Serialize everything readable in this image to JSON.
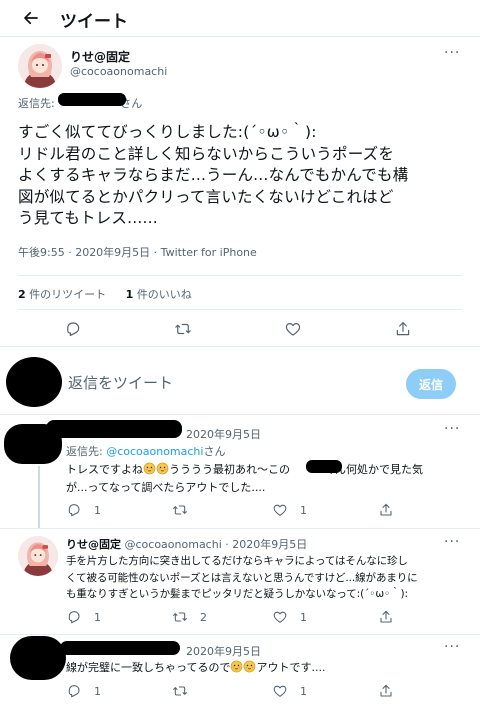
{
  "header": {
    "title": "ツイート"
  },
  "main_tweet": {
    "display_name": "りせ@固定",
    "handle": "@cocoaonomachi",
    "reply_to_prefix": "返信先: ",
    "reply_to_suffix": "さん",
    "body": "すごく似ててびっくりしました:(´◦ω◦｀):\nリドル君のこと詳しく知らないからこういうポーズを\nよくするキャラならまだ...うーん...なんでもかんでも構\n図が似てるとかパクリって言いたくないけどこれはど\nう見てもトレス......",
    "meta": "午後9:55 · 2020年9月5日 · Twitter for iPhone",
    "retweet_count": "2",
    "retweet_label": "件のリツイート",
    "like_count": "1",
    "like_label": "件のいいね"
  },
  "composer": {
    "placeholder": "返信をツイート",
    "reply_button": "返信"
  },
  "replies": [
    {
      "date": "2020年9月5日",
      "reply_to_prefix": "返信先: ",
      "reply_to_handle": "@cocoaonomachi",
      "reply_to_suffix": "さん",
      "line1_a": "トレスですよね",
      "line1_b": "うううう最初あれ～この",
      "line1_c": "くん何処かで見た気",
      "line2": "が...ってなって調べたらアウトでした....",
      "reply_count": "1",
      "like_count": "1"
    },
    {
      "display_name": "りせ@固定",
      "handle": "@cocoaonomachi",
      "date": "2020年9月5日",
      "body": "手を片方した方向に突き出してるだけならキャラによってはそんなに珍し\nくて被る可能性のないポーズとは言えないと思うんですけど...線があまりに\nも重なりすぎというか髪までピッタリだと疑うしかないなって:(´◦ω◦｀):",
      "reply_count": "1",
      "retweet_count": "2",
      "like_count": "1"
    },
    {
      "date": "2020年9月5日",
      "body_a": "線が完璧に一致しちゃってるので",
      "body_b": "アウトです....",
      "reply_count": "1",
      "like_count": "1"
    }
  ],
  "icons": [
    "back-arrow-icon",
    "more-icon",
    "reply-icon",
    "retweet-icon",
    "like-icon",
    "share-icon",
    "emoji-icon"
  ],
  "colors": {
    "accent": "#1d9bf0",
    "accent_disabled": "#8ecdf8",
    "text": "#0f1419",
    "muted": "#536471",
    "border": "#e6ecf0"
  }
}
